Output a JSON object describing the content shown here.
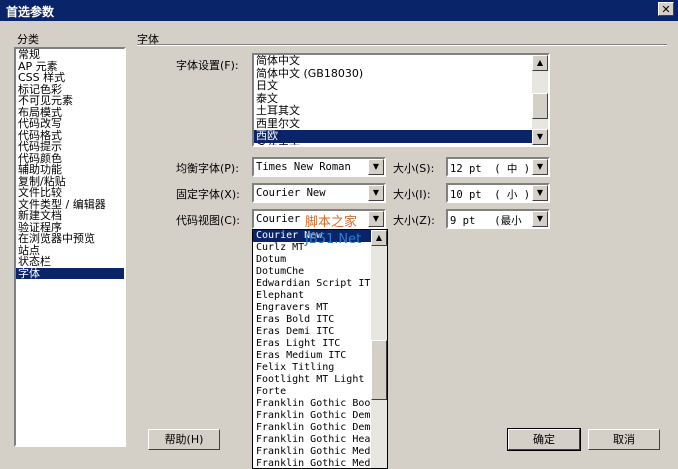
{
  "window": {
    "title": "首选参数",
    "close_glyph": "✕"
  },
  "left": {
    "header": "分类",
    "categories": [
      "常规",
      "AP 元素",
      "CSS 样式",
      "标记色彩",
      "不可见元素",
      "布局模式",
      "代码改写",
      "代码格式",
      "代码提示",
      "代码颜色",
      "辅助功能",
      "复制/粘贴",
      "文件比较",
      "文件类型 / 编辑器",
      "新建文档",
      "验证程序",
      "在浏览器中预览",
      "站点",
      "状态栏",
      "字体"
    ],
    "selected_index": 19
  },
  "right": {
    "header": "字体",
    "encoding_label": "字体设置(F):",
    "encodings": [
      "简体中文",
      "简体中文 (GB18030)",
      "日文",
      "泰文",
      "土耳其文",
      "西里尔文",
      "西欧",
      "希伯来文"
    ],
    "selected_encoding_index": 6,
    "proportional_label": "均衡字体(P):",
    "proportional_value": "Times New Roman",
    "size_label_1": "大小(S):",
    "size_value_1": "12 pt  ( 中 )",
    "fixed_label": "固定字体(X):",
    "fixed_value": "Courier New",
    "size_label_2": "大小(I):",
    "size_value_2": "10 pt  ( 小 )",
    "code_label": "代码视图(C):",
    "code_value": "Courier",
    "size_label_3": "大小(Z):",
    "size_value_3": "9 pt   (最小",
    "font_options": [
      "Courier New",
      "Curlz MT",
      "Dotum",
      "DotumChe",
      "Edwardian Script ITC",
      "Elephant",
      "Engravers MT",
      "Eras Bold ITC",
      "Eras Demi ITC",
      "Eras Light ITC",
      "Eras Medium ITC",
      "Felix Titling",
      "Footlight MT Light",
      "Forte",
      "Franklin Gothic Book",
      "Franklin Gothic Demi",
      "Franklin Gothic Demi Cond",
      "Franklin Gothic Heavy",
      "Franklin Gothic Medium",
      "Franklin Gothic Medium Cond"
    ],
    "selected_font_index": 0
  },
  "buttons": {
    "help": "帮助(H)",
    "ok": "确定",
    "cancel": "取消"
  },
  "watermark": {
    "line1": "脚本之家",
    "line2": "JB51.Net"
  },
  "icons": {
    "up_arrow": "▲",
    "down_arrow": "▼"
  }
}
